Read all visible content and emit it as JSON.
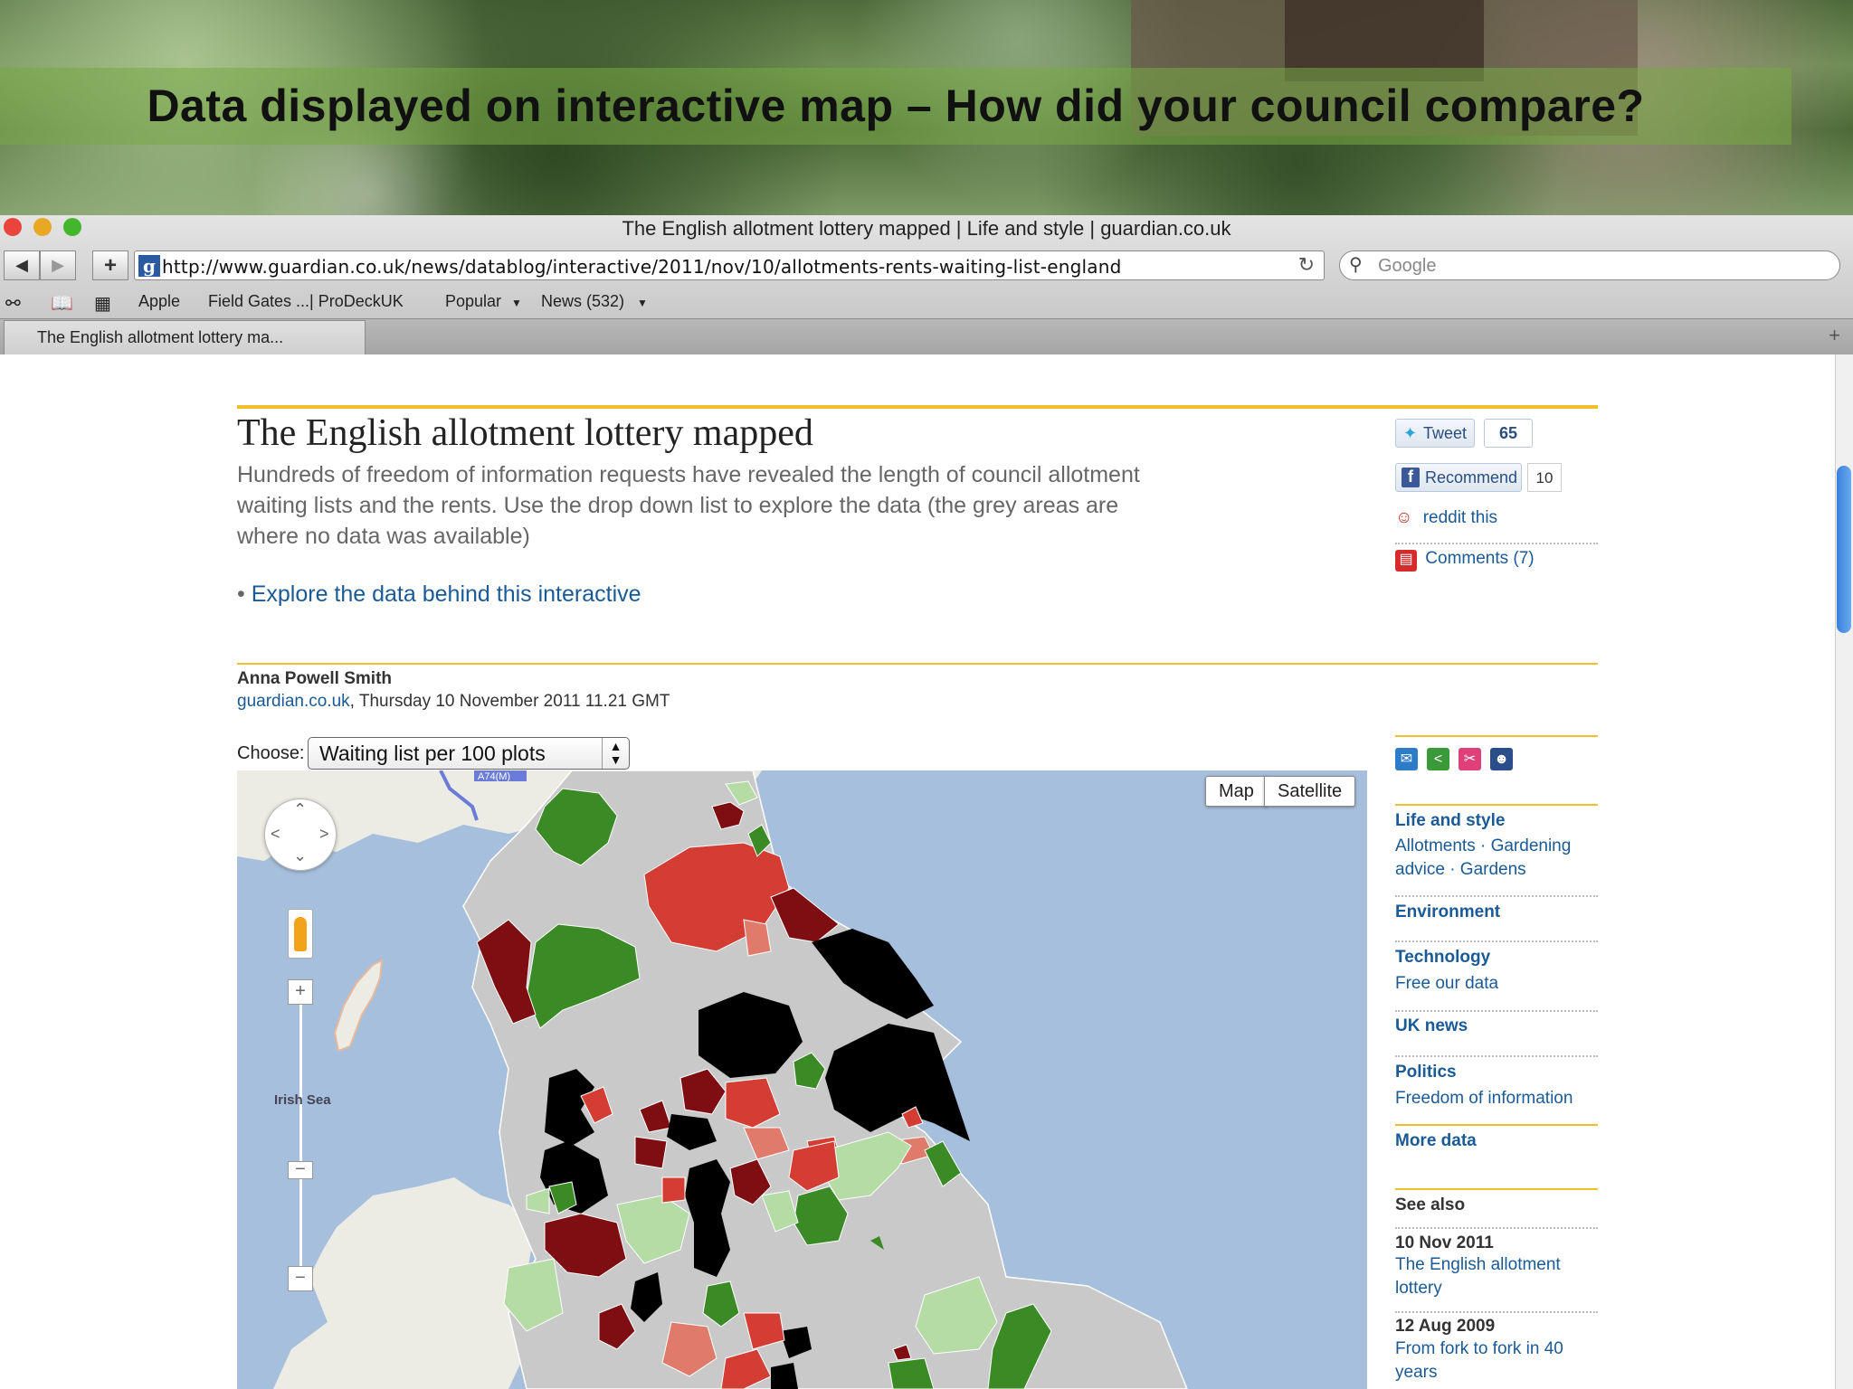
{
  "banner": {
    "heading": "Data displayed on interactive map – How did your council compare?"
  },
  "window": {
    "title": "The English allotment lottery mapped | Life and style | guardian.co.uk",
    "url": "http://www.guardian.co.uk/news/datablog/interactive/2011/nov/10/allotments-rents-waiting-list-england",
    "search_placeholder": "Google",
    "favicon": "g"
  },
  "bookmarks": {
    "items": [
      "Apple",
      "Field Gates ...| ProDeckUK",
      "Popular",
      "News (532)"
    ]
  },
  "tabs": {
    "active": "The English allotment lottery ma..."
  },
  "article": {
    "title": "The English allotment lottery mapped",
    "standfirst": "Hundreds of freedom of information requests have revealed the length of council allotment waiting lists and the rents. Use the drop down list to explore the data (the grey areas are where no data was available)",
    "bullet": "•",
    "explore_link": "Explore the data behind this interactive",
    "author": "Anna Powell Smith",
    "source_link": "guardian.co.uk",
    "date": ", Thursday 10 November 2011 11.21 GMT",
    "choose_label": "Choose:",
    "choose_value": "Waiting list per 100 plots"
  },
  "map": {
    "map_btn": "Map",
    "satellite_btn": "Satellite",
    "sea_label": "Irish Sea",
    "road_label": "A74(M)",
    "colors": {
      "sea": "#a6bfdc",
      "none": "#c9c9c9",
      "black": "#000000",
      "darkred": "#7f0e12",
      "red": "#d33d33",
      "lightred": "#e07a6b",
      "green": "#3a8a25",
      "lightgreen": "#b6dca6",
      "land": "#ecece4"
    }
  },
  "sidebar": {
    "tweet": "Tweet",
    "tweet_count": "65",
    "recommend": "Recommend",
    "recommend_count": "10",
    "reddit": "reddit this",
    "comments": "Comments (7)",
    "sections": [
      {
        "heading": "Life and style",
        "links": "Allotments · Gardening advice · Gardens"
      },
      {
        "heading": "Environment",
        "links": ""
      },
      {
        "heading": "Technology",
        "links": "Free our data"
      },
      {
        "heading": "UK news",
        "links": ""
      },
      {
        "heading": "Politics",
        "links": "Freedom of information"
      },
      {
        "heading": "More data",
        "links": ""
      }
    ],
    "see_also_heading": "See also",
    "see_also": [
      {
        "date": "10 Nov 2011",
        "title": "The English allotment lottery"
      },
      {
        "date": "12 Aug 2009",
        "title": "From fork to fork in 40 years"
      }
    ]
  }
}
